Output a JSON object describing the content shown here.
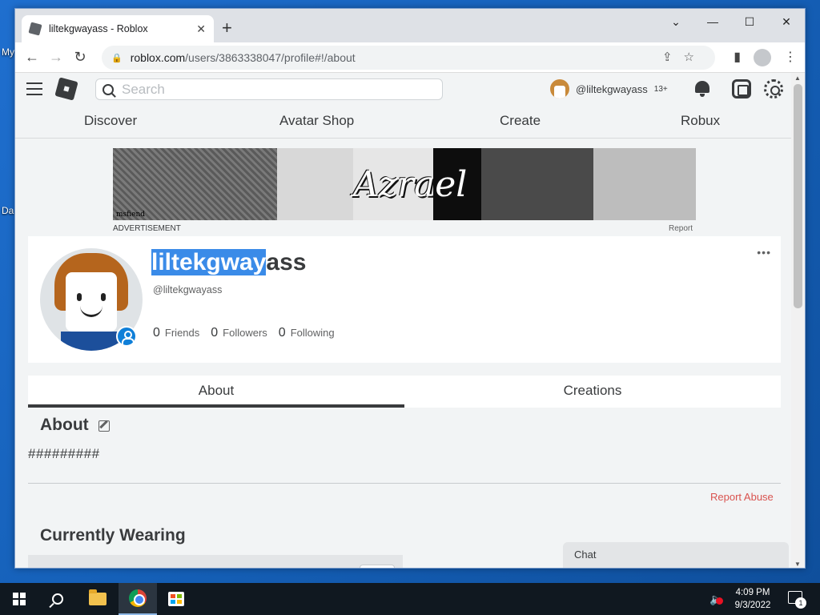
{
  "desktop": {
    "icon_label_1": "My",
    "icon_label_2": "Da"
  },
  "browser": {
    "tab_title": "liltekgwayass - Roblox",
    "url_host": "roblox.com",
    "url_path": "/users/3863338047/profile#!/about",
    "window_controls": {
      "minimize": "—",
      "maximize": "☐",
      "close": "✕",
      "tab_list": "⌄"
    }
  },
  "header": {
    "search_placeholder": "Search",
    "username": "@liltekgwayass",
    "age_badge": "13+"
  },
  "nav": {
    "items": [
      "Discover",
      "Avatar Shop",
      "Create",
      "Robux"
    ]
  },
  "ad": {
    "label": "ADVERTISEMENT",
    "report": "Report",
    "banner_word": "Azrael",
    "signature": "msfiend"
  },
  "profile": {
    "display_name_selected": "liltekgway",
    "display_name_rest": "ass",
    "username": "@liltekgwayass",
    "stats": [
      {
        "count": "0",
        "label": "Friends"
      },
      {
        "count": "0",
        "label": "Followers"
      },
      {
        "count": "0",
        "label": "Following"
      }
    ],
    "more": "•••"
  },
  "tabs": {
    "about": "About",
    "creations": "Creations"
  },
  "about": {
    "heading": "About",
    "text": "#########",
    "report_abuse": "Report Abuse"
  },
  "wearing": {
    "heading": "Currently Wearing"
  },
  "chat": {
    "label": "Chat"
  },
  "taskbar": {
    "time": "4:09 PM",
    "date": "9/3/2022",
    "notification_count": "1"
  }
}
